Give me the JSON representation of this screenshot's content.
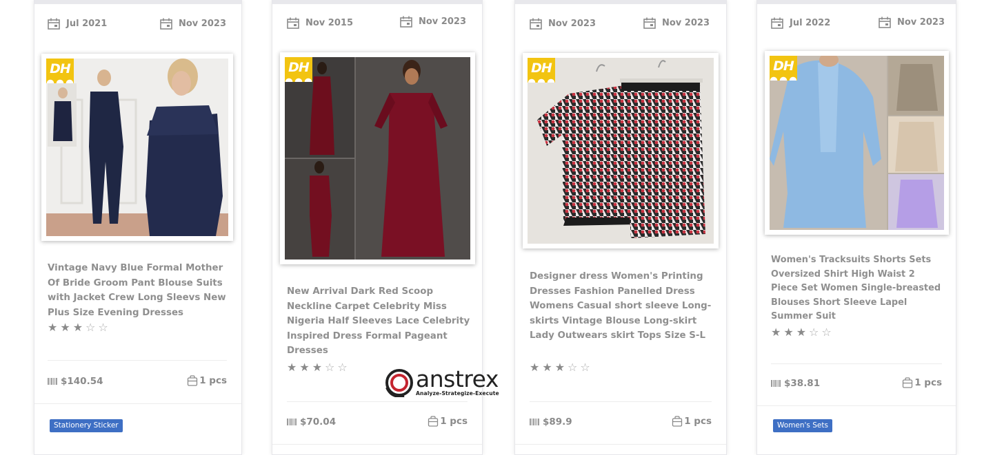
{
  "cards": [
    {
      "date_from": "Jul 2021",
      "date_to": "Nov 2023",
      "image_brand": "DH",
      "title": "Vintage Navy Blue Formal Mother Of Bride Groom Pant Blouse Suits with Jacket Crew Long Sleevs New Plus Size Evening Dresses",
      "rating": 3,
      "price": "$140.54",
      "quantity": "1 pcs",
      "badge": "Stationery Sticker"
    },
    {
      "date_from": "Nov 2015",
      "date_to": "Nov 2023",
      "image_brand": "DH",
      "title": "New Arrival Dark Red Scoop Neckline Carpet Celebrity Miss Nigeria Half Sleeves Lace Celebrity Inspired Dress Formal Pageant Dresses",
      "rating": 3,
      "price": "$70.04",
      "quantity": "1 pcs",
      "badge": ""
    },
    {
      "date_from": "Nov 2023",
      "date_to": "Nov 2023",
      "image_brand": "DH",
      "title": "Designer dress Women's Printing Dresses Fashion Panelled Dress Womens Casual short sleeve Long-skirts Vintage Blouse Long-skirt Lady Outwears skirt Tops Size S-L",
      "rating": 3,
      "price": "$89.9",
      "quantity": "1 pcs",
      "badge": ""
    },
    {
      "date_from": "Jul 2022",
      "date_to": "Nov 2023",
      "image_brand": "DH",
      "title": "Women's Tracksuits Shorts Sets Oversized Shirt High Waist 2 Piece Set Women Single-breasted Blouses Short Sleeve Lapel Summer Suit",
      "rating": 3,
      "price": "$38.81",
      "quantity": "1 pcs",
      "badge": "Women's Sets"
    }
  ],
  "watermark": {
    "brand": "anstrex",
    "tagline": "Analyze-Strategize-Execute"
  },
  "icons": {
    "date": "calendar-icon",
    "price": "barcode-icon",
    "quantity": "shopping-bag-icon",
    "rating": "star-icon"
  },
  "colors": {
    "badge": "#3e6fc4",
    "dh_logo": "#f2c411",
    "text": "#8f8f8f"
  }
}
